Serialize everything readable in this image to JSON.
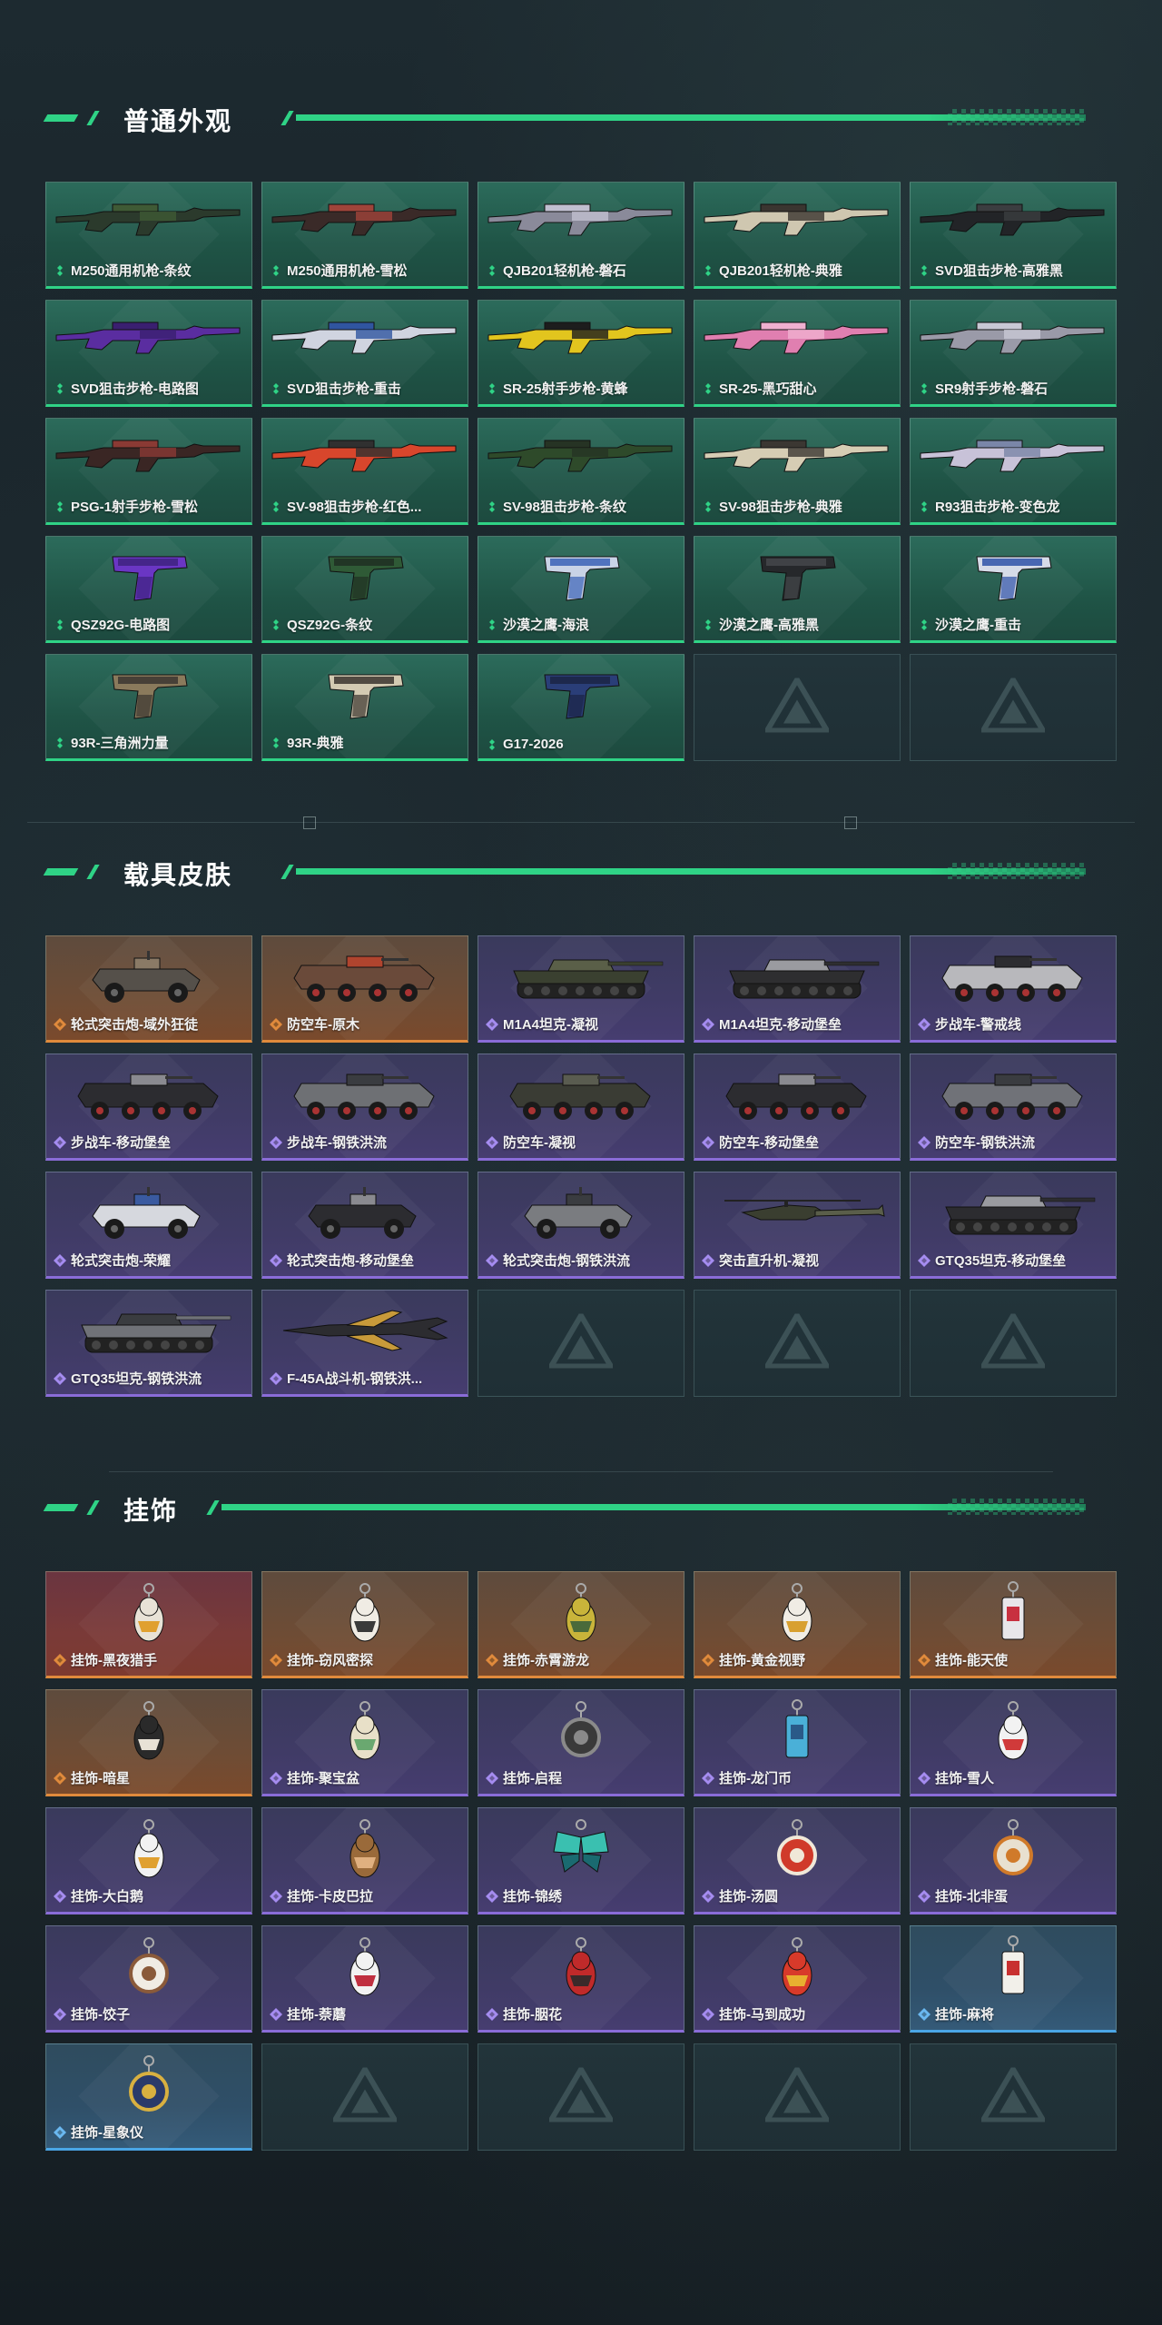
{
  "colors": {
    "accent": "#2fd386",
    "orange": "#e08a3c",
    "purple": "#8a6cd8",
    "blue": "#4aa6e6"
  },
  "sections": [
    {
      "title": "普通外观",
      "items": [
        {
          "label": "M250通用机枪-条纹",
          "type": "gun",
          "rarity": "green",
          "colors": [
            "#2b3a2c",
            "#3f5a35"
          ]
        },
        {
          "label": "M250通用机枪-雪松",
          "type": "gun",
          "rarity": "green",
          "colors": [
            "#3a2a28",
            "#a0443a"
          ]
        },
        {
          "label": "QJB201轻机枪-磐石",
          "type": "gun",
          "rarity": "green",
          "colors": [
            "#8a8a9a",
            "#c0bfd0"
          ]
        },
        {
          "label": "QJB201轻机枪-典雅",
          "type": "gun",
          "rarity": "green",
          "colors": [
            "#cfc7b0",
            "#3a3530"
          ]
        },
        {
          "label": "SVD狙击步枪-高雅黑",
          "type": "gun",
          "rarity": "green",
          "colors": [
            "#222427",
            "#3b3d40"
          ]
        },
        {
          "label": "SVD狙击步枪-电路图",
          "type": "gun",
          "rarity": "green",
          "colors": [
            "#5a2da0",
            "#3a1f70"
          ]
        },
        {
          "label": "SVD狙击步枪-重击",
          "type": "gun",
          "rarity": "green",
          "colors": [
            "#d0d4e0",
            "#3055a0"
          ]
        },
        {
          "label": "SR-25射手步枪-黄蜂",
          "type": "gun",
          "rarity": "green",
          "colors": [
            "#e2c51e",
            "#1d1d1d"
          ]
        },
        {
          "label": "SR-25-黑巧甜心",
          "type": "gun",
          "rarity": "green",
          "colors": [
            "#e07fb0",
            "#f0b0d0"
          ]
        },
        {
          "label": "SR9射手步枪-磐石",
          "type": "gun",
          "rarity": "green",
          "colors": [
            "#9a9aa8",
            "#c8c8d4"
          ]
        },
        {
          "label": "PSG-1射手步枪-雪松",
          "type": "gun",
          "rarity": "green",
          "colors": [
            "#3a2624",
            "#8a3a34"
          ]
        },
        {
          "label": "SV-98狙击步枪-红色...",
          "type": "gun",
          "rarity": "green",
          "colors": [
            "#d8462c",
            "#303030"
          ]
        },
        {
          "label": "SV-98狙击步枪-条纹",
          "type": "gun",
          "rarity": "green",
          "colors": [
            "#2e4a2a",
            "#263324"
          ]
        },
        {
          "label": "SV-98狙击步枪-典雅",
          "type": "gun",
          "rarity": "green",
          "colors": [
            "#d6cdb4",
            "#3b3732"
          ]
        },
        {
          "label": "R93狙击步枪-变色龙",
          "type": "gun",
          "rarity": "green",
          "colors": [
            "#c8c2d8",
            "#7a86a8"
          ]
        },
        {
          "label": "QSZ92G-电路图",
          "type": "pistol",
          "rarity": "green",
          "colors": [
            "#6a36c4",
            "#3e2280"
          ]
        },
        {
          "label": "QSZ92G-条纹",
          "type": "pistol",
          "rarity": "green",
          "colors": [
            "#2f5a36",
            "#1f2f22"
          ]
        },
        {
          "label": "沙漠之鹰-海浪",
          "type": "pistol",
          "rarity": "green",
          "colors": [
            "#c9d3e6",
            "#3b62b6"
          ]
        },
        {
          "label": "沙漠之鹰-高雅黑",
          "type": "pistol",
          "rarity": "green",
          "colors": [
            "#26282b",
            "#45474b"
          ]
        },
        {
          "label": "沙漠之鹰-重击",
          "type": "pistol",
          "rarity": "green",
          "colors": [
            "#d6dbe8",
            "#2f52a8"
          ]
        },
        {
          "label": "93R-三角洲力量",
          "type": "pistol",
          "rarity": "green",
          "colors": [
            "#8a7a5c",
            "#3b3630"
          ]
        },
        {
          "label": "93R-典雅",
          "type": "pistol",
          "rarity": "green",
          "colors": [
            "#d3cab2",
            "#3a342e"
          ]
        },
        {
          "label": "G17-2026",
          "type": "pistol",
          "rarity": "green",
          "colors": [
            "#2a3e78",
            "#1b2444"
          ]
        }
      ],
      "empty_slots": 2
    },
    {
      "title": "载具皮肤",
      "items": [
        {
          "label": "轮式突击炮-域外狂徒",
          "type": "apc4",
          "rarity": "orange",
          "colors": [
            "#55504a",
            "#8a7a66"
          ]
        },
        {
          "label": "防空车-原木",
          "type": "apc8",
          "rarity": "orange",
          "colors": [
            "#6a4a3a",
            "#b0442e"
          ]
        },
        {
          "label": "M1A4坦克-凝视",
          "type": "tank",
          "rarity": "purple",
          "colors": [
            "#3a4030",
            "#5a5f48"
          ]
        },
        {
          "label": "M1A4坦克-移动堡垒",
          "type": "tank",
          "rarity": "purple",
          "colors": [
            "#2e2e30",
            "#9a9ba0"
          ]
        },
        {
          "label": "步战车-警戒线",
          "type": "apc8",
          "rarity": "purple",
          "colors": [
            "#b8b8bc",
            "#2c2c30"
          ]
        },
        {
          "label": "步战车-移动堡垒",
          "type": "apc8",
          "rarity": "purple",
          "colors": [
            "#2c2c30",
            "#8a8a90"
          ]
        },
        {
          "label": "步战车-钢铁洪流",
          "type": "apc8",
          "rarity": "purple",
          "colors": [
            "#6e7074",
            "#3a3c40"
          ]
        },
        {
          "label": "防空车-凝视",
          "type": "apc8",
          "rarity": "purple",
          "colors": [
            "#3a3c34",
            "#5a5c50"
          ]
        },
        {
          "label": "防空车-移动堡垒",
          "type": "apc8",
          "rarity": "purple",
          "colors": [
            "#2c2c30",
            "#8a8a90"
          ]
        },
        {
          "label": "防空车-钢铁洪流",
          "type": "apc8",
          "rarity": "purple",
          "colors": [
            "#707278",
            "#3a3c40"
          ]
        },
        {
          "label": "轮式突击炮-荣耀",
          "type": "apc4",
          "rarity": "purple",
          "colors": [
            "#d6d8de",
            "#3a5aa0"
          ]
        },
        {
          "label": "轮式突击炮-移动堡垒",
          "type": "apc4",
          "rarity": "purple",
          "colors": [
            "#2c2c30",
            "#8a8a90"
          ]
        },
        {
          "label": "轮式突击炮-钢铁洪流",
          "type": "apc4",
          "rarity": "purple",
          "colors": [
            "#7a7c80",
            "#3a3c40"
          ]
        },
        {
          "label": "突击直升机-凝视",
          "type": "heli",
          "rarity": "purple",
          "colors": [
            "#3a3e30",
            "#5a5e4a"
          ]
        },
        {
          "label": "GTQ35坦克-移动堡垒",
          "type": "tank",
          "rarity": "purple",
          "colors": [
            "#2c2c30",
            "#9a9ba0"
          ]
        },
        {
          "label": "GTQ35坦克-钢铁洪流",
          "type": "tank",
          "rarity": "purple",
          "colors": [
            "#707278",
            "#3a3c40"
          ]
        },
        {
          "label": "F-45A战斗机-钢铁洪...",
          "type": "jet",
          "rarity": "purple",
          "colors": [
            "#2c2c30",
            "#c89a3a"
          ]
        }
      ],
      "empty_slots": 3
    },
    {
      "title": "挂饰",
      "items": [
        {
          "label": "挂饰-黑夜猎手",
          "type": "charm",
          "rarity": "red",
          "colors": [
            "#e8e2d6",
            "#e0a030"
          ]
        },
        {
          "label": "挂饰-窃风密探",
          "type": "charm",
          "rarity": "orange",
          "colors": [
            "#f0ece4",
            "#3a3a3a"
          ]
        },
        {
          "label": "挂饰-赤霄游龙",
          "type": "charm",
          "rarity": "orange",
          "colors": [
            "#c9b43a",
            "#4a6a3a"
          ]
        },
        {
          "label": "挂饰-黄金视野",
          "type": "charm",
          "rarity": "orange",
          "colors": [
            "#f0ece4",
            "#d8a030"
          ]
        },
        {
          "label": "挂饰-能天使",
          "type": "tag",
          "rarity": "orange",
          "colors": [
            "#e8e6ea",
            "#c83040"
          ]
        },
        {
          "label": "挂饰-暗星",
          "type": "charm",
          "rarity": "orange",
          "colors": [
            "#2a2a2a",
            "#e8e2d6"
          ]
        },
        {
          "label": "挂饰-聚宝盆",
          "type": "charm",
          "rarity": "purple",
          "colors": [
            "#e8e0c8",
            "#6aa870"
          ]
        },
        {
          "label": "挂饰-启程",
          "type": "ring",
          "rarity": "purple",
          "colors": [
            "#3a3a3a",
            "#8a8a8a"
          ]
        },
        {
          "label": "挂饰-龙门币",
          "type": "tag",
          "rarity": "purple",
          "colors": [
            "#4ab0d8",
            "#2a5a88"
          ]
        },
        {
          "label": "挂饰-雪人",
          "type": "charm",
          "rarity": "purple",
          "colors": [
            "#f2f2f2",
            "#d03a3a"
          ]
        },
        {
          "label": "挂饰-大白鹅",
          "type": "charm",
          "rarity": "purple",
          "colors": [
            "#f2f2f2",
            "#e0a030"
          ]
        },
        {
          "label": "挂饰-卡皮巴拉",
          "type": "charm",
          "rarity": "purple",
          "colors": [
            "#9a6a3a",
            "#e0b080"
          ]
        },
        {
          "label": "挂饰-锦绣",
          "type": "butterfly",
          "rarity": "purple",
          "colors": [
            "#3ac0b0",
            "#1a6a70"
          ]
        },
        {
          "label": "挂饰-汤圆",
          "type": "ring",
          "rarity": "purple",
          "colors": [
            "#d03a2a",
            "#f0e8d8"
          ]
        },
        {
          "label": "挂饰-北非蛋",
          "type": "ring",
          "rarity": "purple",
          "colors": [
            "#e8e0d0",
            "#d07a2a"
          ]
        },
        {
          "label": "挂饰-饺子",
          "type": "ring",
          "rarity": "purple",
          "colors": [
            "#f0ece4",
            "#8a5a3a"
          ]
        },
        {
          "label": "挂饰-萘蘑",
          "type": "charm",
          "rarity": "purple",
          "colors": [
            "#f2f2f2",
            "#c03040"
          ]
        },
        {
          "label": "挂饰-胭花",
          "type": "charm",
          "rarity": "purple",
          "colors": [
            "#c02a2a",
            "#3a2a2a"
          ]
        },
        {
          "label": "挂饰-马到成功",
          "type": "charm",
          "rarity": "purple",
          "colors": [
            "#d83a2a",
            "#e8b030"
          ]
        },
        {
          "label": "挂饰-麻将",
          "type": "tag",
          "rarity": "blue",
          "colors": [
            "#f2f0ea",
            "#c83030"
          ]
        },
        {
          "label": "挂饰-星象仪",
          "type": "ring",
          "rarity": "blue",
          "colors": [
            "#2a3a6a",
            "#d8b040"
          ]
        }
      ],
      "empty_slots": 4
    }
  ]
}
